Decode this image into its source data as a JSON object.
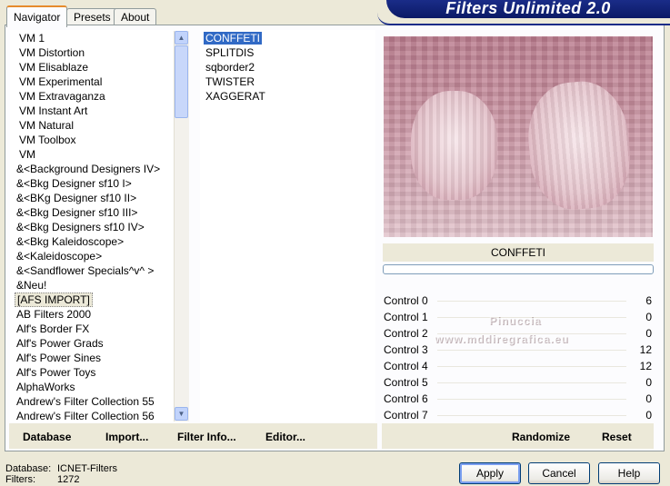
{
  "banner": {
    "title": "Filters Unlimited 2.0"
  },
  "tabs": [
    "Navigator",
    "Presets",
    "About"
  ],
  "categories": [
    "VM 1",
    "VM Distortion",
    "VM Elisablaze",
    "VM Experimental",
    "VM Extravaganza",
    "VM Instant Art",
    "VM Natural",
    "VM Toolbox",
    "VM",
    "&<Background Designers IV>",
    "&<Bkg Designer sf10 I>",
    "&<BKg Designer sf10 II>",
    "&<Bkg Designer sf10 III>",
    "&<Bkg Designers sf10 IV>",
    "&<Bkg Kaleidoscope>",
    "&<Kaleidoscope>",
    "&<Sandflower Specials^v^ >",
    "&Neu!",
    "[AFS IMPORT]",
    "AB Filters 2000",
    "Alf's Border FX",
    "Alf's Power Grads",
    "Alf's Power Sines",
    "Alf's Power Toys",
    "AlphaWorks",
    "Andrew's Filter Collection 55",
    "Andrew's Filter Collection 56"
  ],
  "selected_category": "[AFS IMPORT]",
  "filters": [
    "CONFFETI",
    "SPLITDIS",
    "sqborder2",
    "TWISTER",
    "XAGGERAT"
  ],
  "selected_filter": "CONFFETI",
  "preview": {
    "filter_name": "CONFFETI",
    "watermark_line1": "Pinuccia",
    "watermark_line2": "www.mddiregrafica.eu"
  },
  "controls": [
    {
      "label": "Control 0",
      "value": "6"
    },
    {
      "label": "Control 1",
      "value": "0"
    },
    {
      "label": "Control 2",
      "value": "0"
    },
    {
      "label": "Control 3",
      "value": "12"
    },
    {
      "label": "Control 4",
      "value": "12"
    },
    {
      "label": "Control 5",
      "value": "0"
    },
    {
      "label": "Control 6",
      "value": "0"
    },
    {
      "label": "Control 7",
      "value": "0"
    }
  ],
  "buttons": {
    "database": "Database",
    "import": "Import...",
    "filter_info": "Filter Info...",
    "editor": "Editor...",
    "randomize": "Randomize",
    "reset": "Reset",
    "apply": "Apply",
    "cancel": "Cancel",
    "help": "Help"
  },
  "footer": {
    "database_label": "Database:",
    "database_value": "ICNET-Filters",
    "filters_label": "Filters:",
    "filters_value": "1272"
  },
  "colors": {
    "banner": "#0b1a66",
    "selection": "#316ac5",
    "window": "#ece9d8"
  }
}
